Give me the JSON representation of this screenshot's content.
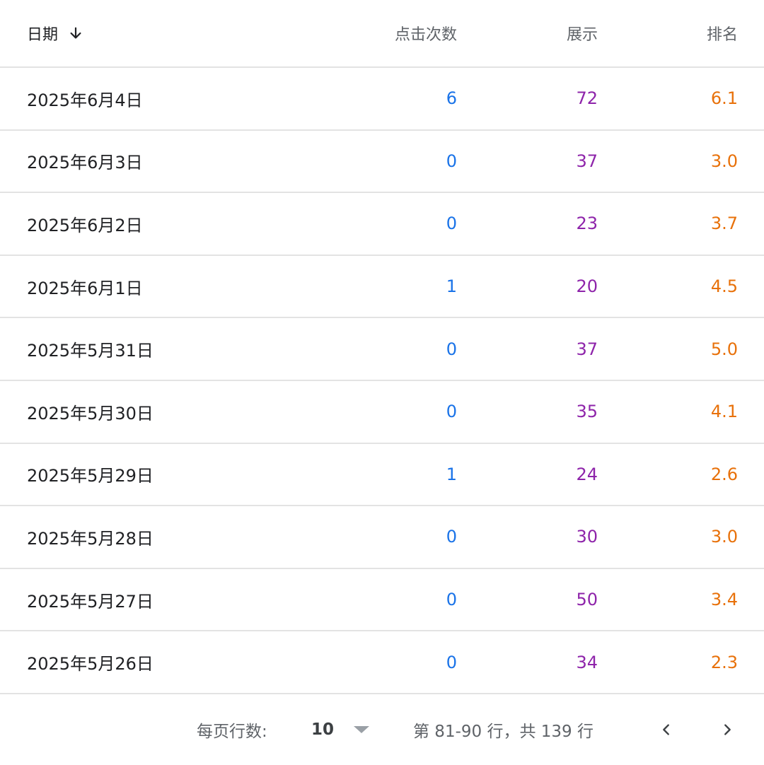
{
  "header": {
    "date": "日期",
    "clicks": "点击次数",
    "impressions": "展示",
    "position": "排名",
    "sort_icon": "arrow-down-icon"
  },
  "rows": [
    {
      "date": "2025年6月4日",
      "clicks": "6",
      "impressions": "72",
      "position": "6.1"
    },
    {
      "date": "2025年6月3日",
      "clicks": "0",
      "impressions": "37",
      "position": "3.0"
    },
    {
      "date": "2025年6月2日",
      "clicks": "0",
      "impressions": "23",
      "position": "3.7"
    },
    {
      "date": "2025年6月1日",
      "clicks": "1",
      "impressions": "20",
      "position": "4.5"
    },
    {
      "date": "2025年5月31日",
      "clicks": "0",
      "impressions": "37",
      "position": "5.0"
    },
    {
      "date": "2025年5月30日",
      "clicks": "0",
      "impressions": "35",
      "position": "4.1"
    },
    {
      "date": "2025年5月29日",
      "clicks": "1",
      "impressions": "24",
      "position": "2.6"
    },
    {
      "date": "2025年5月28日",
      "clicks": "0",
      "impressions": "30",
      "position": "3.0"
    },
    {
      "date": "2025年5月27日",
      "clicks": "0",
      "impressions": "50",
      "position": "3.4"
    },
    {
      "date": "2025年5月26日",
      "clicks": "0",
      "impressions": "34",
      "position": "2.3"
    }
  ],
  "footer": {
    "rows_per_page_label": "每页行数:",
    "rows_per_page_value": "10",
    "range_label": "第 81-90 行，共 139 行",
    "prev_icon": "chevron-left-icon",
    "next_icon": "chevron-right-icon"
  },
  "colors": {
    "clicks": "#1a73e8",
    "impressions": "#8e24aa",
    "position": "#e8710a",
    "divider": "#e3e3e3"
  }
}
